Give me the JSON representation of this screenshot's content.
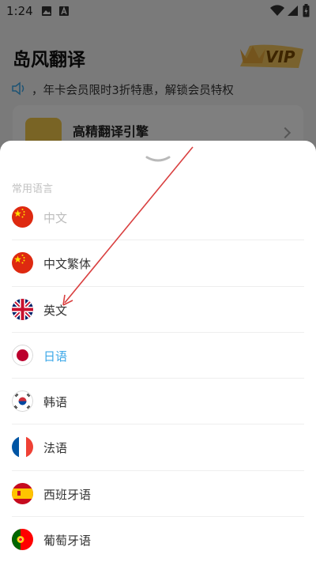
{
  "status_bar": {
    "time": "1:24"
  },
  "app": {
    "title": "岛风翻译",
    "vip_label": "VIP",
    "promo_text": "，年卡会员限时3折特惠，解锁会员特权",
    "engine_card_title": "高精翻译引擎"
  },
  "sheet": {
    "section_label": "常用语言",
    "languages": [
      {
        "label": "中文",
        "flag": "cn-flag-icon",
        "state": "disabled"
      },
      {
        "label": "中文繁体",
        "flag": "cn-flag-icon",
        "state": "normal"
      },
      {
        "label": "英文",
        "flag": "uk-flag-icon",
        "state": "normal"
      },
      {
        "label": "日语",
        "flag": "jp-flag-icon",
        "state": "selected"
      },
      {
        "label": "韩语",
        "flag": "kr-flag-icon",
        "state": "normal"
      },
      {
        "label": "法语",
        "flag": "fr-flag-icon",
        "state": "normal"
      },
      {
        "label": "西班牙语",
        "flag": "es-flag-icon",
        "state": "normal"
      },
      {
        "label": "葡萄牙语",
        "flag": "pt-flag-icon",
        "state": "normal"
      }
    ]
  },
  "colors": {
    "accent": "#3aa7e8",
    "disabled_text": "#bdbdbd",
    "annotation_arrow": "#d94040"
  }
}
